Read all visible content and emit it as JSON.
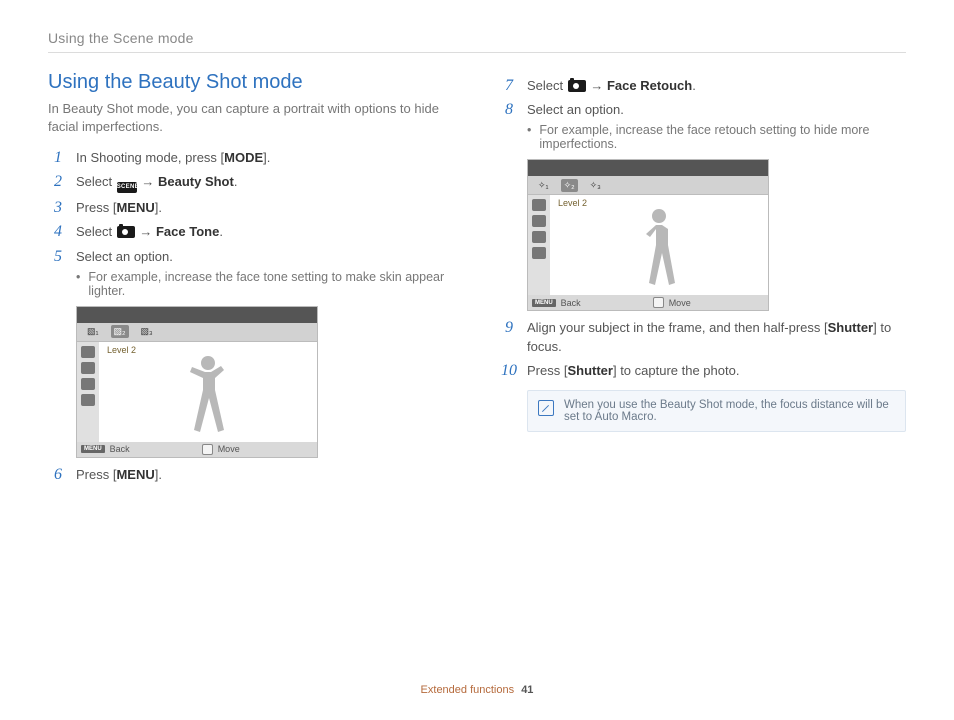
{
  "header": "Using the Scene mode",
  "heading": "Using the Beauty Shot mode",
  "intro": "In Beauty Shot mode, you can capture a portrait with options to hide facial imperfections.",
  "steps": {
    "s1": {
      "pre": "In Shooting mode, press [",
      "btn": "MODE",
      "post": "]."
    },
    "s2": {
      "pre": "Select ",
      "scene_alt": "SCENE",
      "arrow": " → ",
      "bold": "Beauty Shot",
      "post": "."
    },
    "s3": {
      "pre": "Press [",
      "btn": "MENU",
      "post": "]."
    },
    "s4": {
      "pre": "Select ",
      "arrow": " → ",
      "bold": "Face Tone",
      "post": "."
    },
    "s5": {
      "txt": "Select an option.",
      "bullet": "For example, increase the face tone setting to make skin appear lighter."
    },
    "s6": {
      "pre": "Press [",
      "btn": "MENU",
      "post": "]."
    },
    "s7": {
      "pre": "Select ",
      "arrow": " → ",
      "bold": "Face Retouch",
      "post": "."
    },
    "s8": {
      "txt": "Select an option.",
      "bullet": "For example, increase the face retouch setting to hide more imperfections."
    },
    "s9": {
      "pre": "Align your subject in the frame, and then half-press [",
      "btn": "Shutter",
      "post": "] to focus."
    },
    "s10": {
      "pre": "Press [",
      "btn": "Shutter",
      "post": "] to capture the photo."
    }
  },
  "preview": {
    "label": "Level 2",
    "menu_tag": "MENU",
    "back": "Back",
    "move": "Move"
  },
  "note": "When you use the Beauty Shot mode, the focus distance will be set to Auto Macro.",
  "footer": {
    "section": "Extended functions",
    "page": "41"
  }
}
